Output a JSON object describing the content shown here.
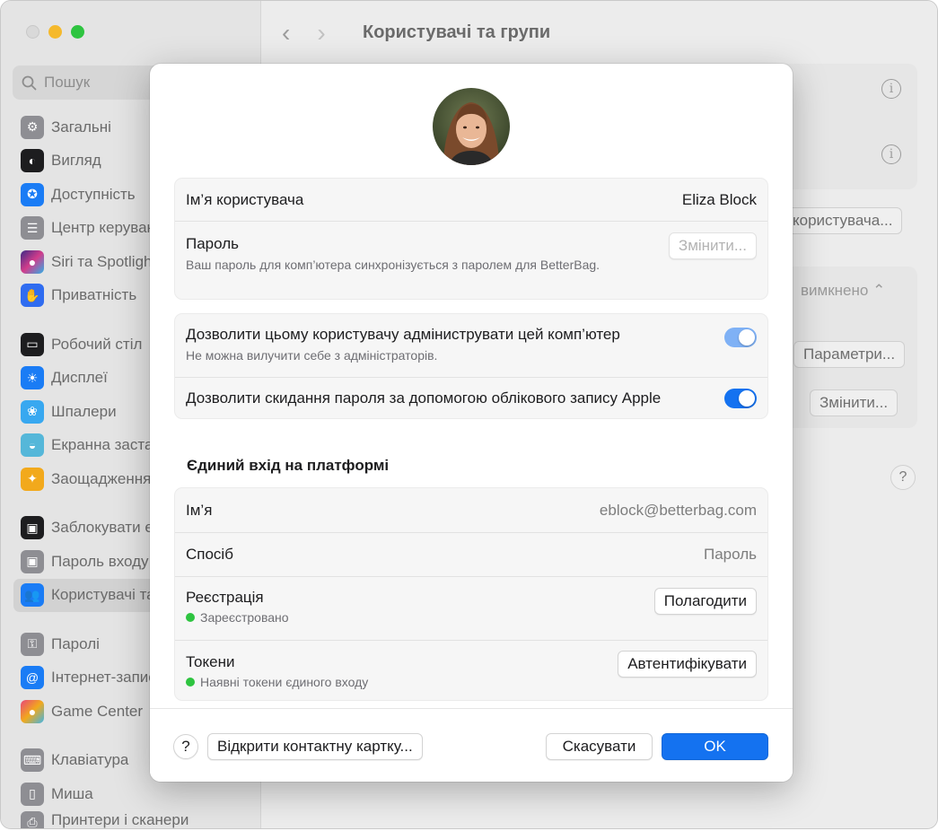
{
  "sidebar": {
    "search_placeholder": "Пошук",
    "items": [
      {
        "label": "Загальні",
        "icon": "gear-icon",
        "color": "#8e8e93"
      },
      {
        "label": "Вигляд",
        "icon": "appearance-icon",
        "color": "#1d1d1f"
      },
      {
        "label": "Доступність",
        "icon": "accessibility-icon",
        "color": "#1a7cf5"
      },
      {
        "label": "Центр керування",
        "icon": "control-center-icon",
        "color": "#8e8e93"
      },
      {
        "label": "Siri та Spotlight",
        "icon": "siri-icon",
        "color": "#5b3bd6"
      },
      {
        "label": "Приватність",
        "icon": "hand-icon",
        "color": "#2f6cf0"
      },
      {
        "label": "Робочий стіл",
        "icon": "desktop-icon",
        "color": "#1d1d1f"
      },
      {
        "label": "Дисплеї",
        "icon": "display-icon",
        "color": "#1a7cf5"
      },
      {
        "label": "Шпалери",
        "icon": "wallpaper-icon",
        "color": "#38a8f0"
      },
      {
        "label": "Екранна заставка",
        "icon": "screensaver-icon",
        "color": "#55b7d9"
      },
      {
        "label": "Заощадження енергії",
        "icon": "lightbulb-icon",
        "color": "#f2a91c"
      },
      {
        "label": "Заблокувати екран",
        "icon": "lock-icon",
        "color": "#1d1d1f"
      },
      {
        "label": "Пароль входу",
        "icon": "lock-icon",
        "color": "#8e8e93"
      },
      {
        "label": "Користувачі та групи",
        "icon": "users-icon",
        "color": "#1a7cf5"
      },
      {
        "label": "Паролі",
        "icon": "key-icon",
        "color": "#8e8e93"
      },
      {
        "label": "Інтернет-записи",
        "icon": "at-icon",
        "color": "#1a7cf5"
      },
      {
        "label": "Game Center",
        "icon": "game-center-icon",
        "color": "#e8457a"
      },
      {
        "label": "Клавіатура",
        "icon": "keyboard-icon",
        "color": "#8e8e93"
      },
      {
        "label": "Миша",
        "icon": "mouse-icon",
        "color": "#8e8e93"
      },
      {
        "label": "Принтери і сканери",
        "icon": "printer-icon",
        "color": "#8e8e93"
      }
    ]
  },
  "main": {
    "title": "Користувачі та групи",
    "add_user_label": "користувача...",
    "auto_login_value": "вимкнено",
    "params_label": "Параметри...",
    "change_label": "Змінити..."
  },
  "dialog": {
    "username_label": "Ім’я користувача",
    "username_value": "Eliza Block",
    "password_label": "Пароль",
    "password_sub": "Ваш пароль для комп’ютера синхронізується з паролем для BetterBag.",
    "password_button": "Змінити...",
    "admin_label": "Дозволити цьому користувачу адміниструвати цей комп’ютер",
    "admin_sub": "Не можна вилучити себе з адміністраторів.",
    "admin_on": true,
    "reset_label": "Дозволити скидання пароля за допомогою облікового запису Apple",
    "reset_on": true,
    "sso_title": "Єдиний вхід на платформі",
    "sso_name_label": "Ім’я",
    "sso_name_value": "eblock@betterbag.com",
    "sso_method_label": "Спосіб",
    "sso_method_value": "Пароль",
    "sso_reg_label": "Реєстрація",
    "sso_reg_status": "Зареєстровано",
    "sso_reg_button": "Полагодити",
    "sso_tokens_label": "Токени",
    "sso_tokens_status": "Наявні токени єдиного входу",
    "sso_tokens_button": "Автентифікувати",
    "help_label": "?",
    "open_card_label": "Відкрити контактну картку...",
    "cancel_label": "Скасувати",
    "ok_label": "OK"
  },
  "colors": {
    "accent": "#1472f0",
    "status_green": "#2ec440"
  }
}
